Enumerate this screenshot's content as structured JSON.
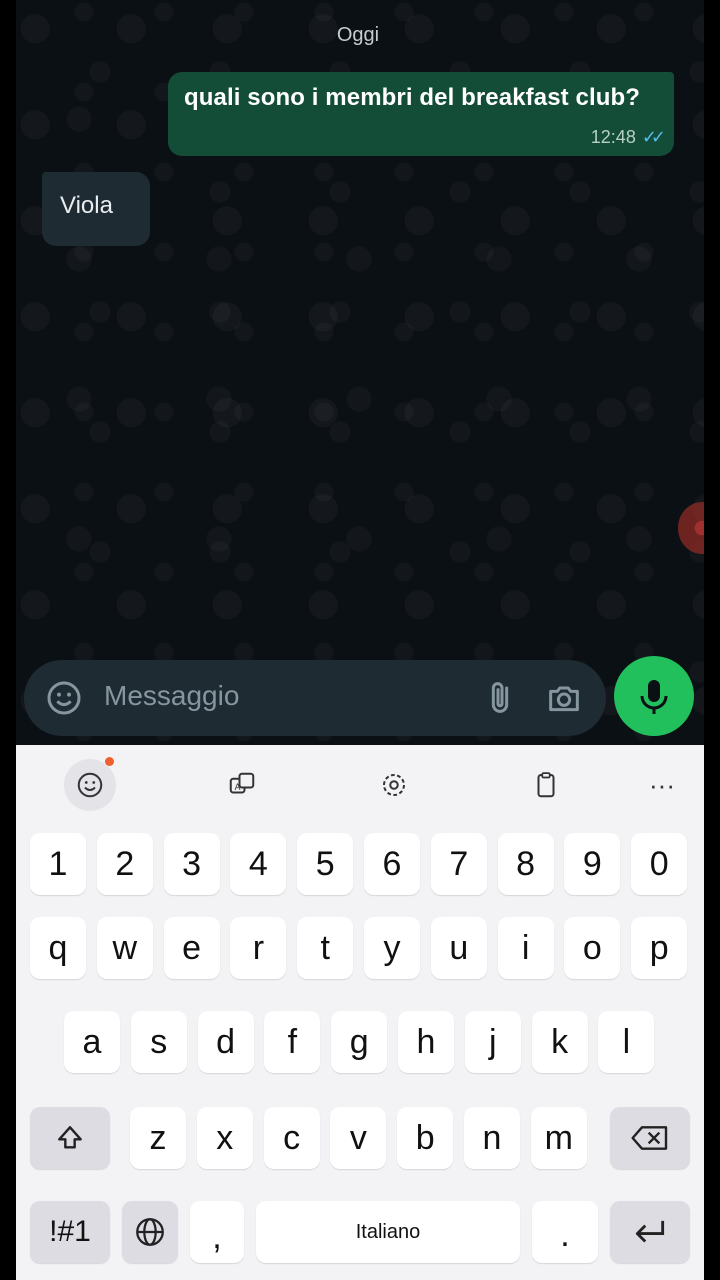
{
  "chat": {
    "date_label": "Oggi",
    "outgoing_message": {
      "text": "quali sono i membri del breakfast club?",
      "time": "12:48",
      "status": "read"
    },
    "incoming_message": {
      "text": "Viola"
    }
  },
  "composer": {
    "placeholder": "Messaggio",
    "emoji_icon": "emoji-icon",
    "attach_icon": "paperclip-icon",
    "camera_icon": "camera-icon",
    "mic_icon": "mic-icon",
    "accent": "#22c05d"
  },
  "keyboard": {
    "toolbar": [
      "emoji-sticker-icon",
      "translate-icon",
      "settings-icon",
      "clipboard-icon",
      "more-icon"
    ],
    "row_numbers": [
      "1",
      "2",
      "3",
      "4",
      "5",
      "6",
      "7",
      "8",
      "9",
      "0"
    ],
    "row_top": [
      "q",
      "w",
      "e",
      "r",
      "t",
      "y",
      "u",
      "i",
      "o",
      "p"
    ],
    "row_middle": [
      "a",
      "s",
      "d",
      "f",
      "g",
      "h",
      "j",
      "k",
      "l"
    ],
    "row_bottom": [
      "z",
      "x",
      "c",
      "v",
      "b",
      "n",
      "m"
    ],
    "symbols_label": "!#1",
    "comma_label": ",",
    "space_label": "Italiano",
    "period_label": "."
  }
}
